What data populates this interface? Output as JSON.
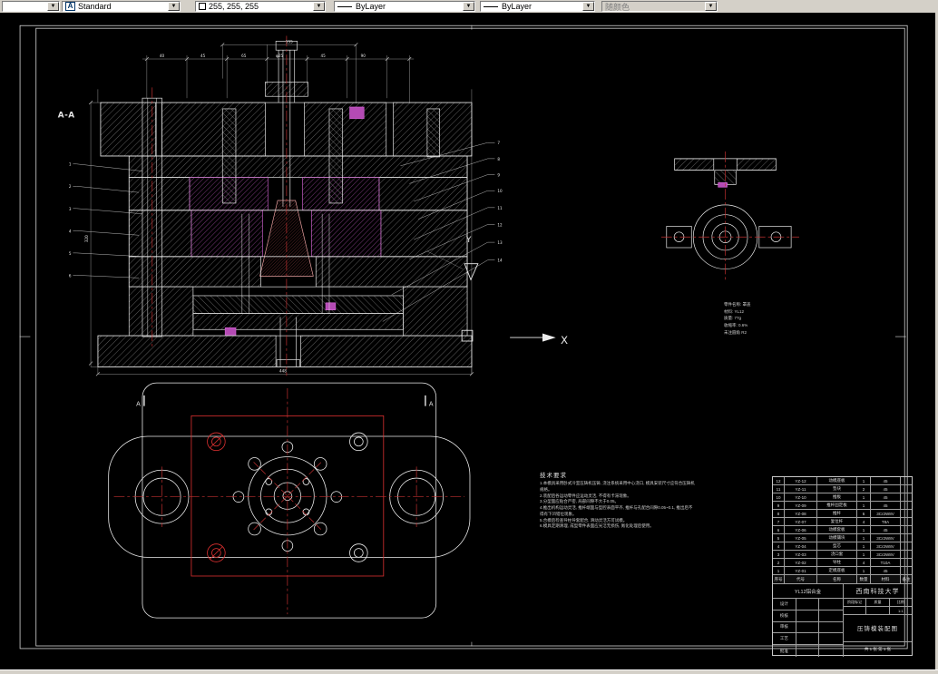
{
  "toolbar": {
    "layer_value": "",
    "style_value": "Standard",
    "style_icon": "A",
    "color_value": "255, 255, 255",
    "color_swatch": "#ffffff",
    "linetype_value": "ByLayer",
    "lineweight_value": "ByLayer",
    "plotstyle_value": "随颜色"
  },
  "drawing": {
    "section_label": "A-A",
    "plan_arrow_left": "A",
    "plan_arrow_right": "A",
    "ucs": {
      "x": "X",
      "y": "Y"
    },
    "dims": {
      "top": [
        "40",
        "45",
        "65",
        "φ25",
        "45",
        "90"
      ],
      "top_overall": "155",
      "left_overall": "320",
      "bottom_overall": "448"
    },
    "balloons": {
      "left": [
        "1",
        "2",
        "3",
        "4",
        "5",
        "6"
      ],
      "right": [
        "7",
        "8",
        "9",
        "10",
        "11",
        "12",
        "13",
        "14"
      ]
    },
    "part_params": [
      "零件名称: 罩盖",
      "材料: YL12",
      "质量: 77g",
      "收缩率: 0.6%",
      "未注圆角 R2"
    ],
    "tech_notes": {
      "title": "技术要求",
      "lines": [
        "1.本模具采用卧式冷室压铸机压铸, 浇注系统采用中心浇口, 模具安装尺寸应符合压铸机规格。",
        "2.装配后各运动零件应运动灵活, 不得有卡滞现象。",
        "3.分型面应贴合严密, 局部间隙不大于0.05。",
        "4.推出机构运动灵活, 推杆端面与型腔表面平齐, 推杆与孔配合间隙0.05~0.1, 推出后不得有下凹错位现象。",
        "5.合模后检查导柱导套配合, 滑动灵活方可试模。",
        "6.模具定期清理, 成型零件表面应光洁无损伤, 氮化处理后使用。"
      ]
    }
  },
  "title_block": {
    "header": {
      "seq": "序号",
      "code": "代号",
      "name": "名称",
      "qty": "数量",
      "material": "材料",
      "note": "备注"
    },
    "parts": [
      {
        "seq": "12",
        "code": "YZ-12",
        "name": "动模座板",
        "qty": "1",
        "material": "45",
        "note": ""
      },
      {
        "seq": "11",
        "code": "YZ-11",
        "name": "垫块",
        "qty": "2",
        "material": "45",
        "note": ""
      },
      {
        "seq": "10",
        "code": "YZ-10",
        "name": "推板",
        "qty": "1",
        "material": "45",
        "note": ""
      },
      {
        "seq": "9",
        "code": "YZ-09",
        "name": "推杆固定板",
        "qty": "1",
        "material": "45",
        "note": ""
      },
      {
        "seq": "8",
        "code": "YZ-08",
        "name": "推杆",
        "qty": "6",
        "material": "3Cr2W8V",
        "note": ""
      },
      {
        "seq": "7",
        "code": "YZ-07",
        "name": "复位杆",
        "qty": "4",
        "material": "T8A",
        "note": ""
      },
      {
        "seq": "6",
        "code": "YZ-06",
        "name": "动模套板",
        "qty": "1",
        "material": "45",
        "note": ""
      },
      {
        "seq": "5",
        "code": "YZ-05",
        "name": "动模镶块",
        "qty": "1",
        "material": "3Cr2W8V",
        "note": ""
      },
      {
        "seq": "4",
        "code": "YZ-04",
        "name": "型芯",
        "qty": "1",
        "material": "3Cr2W8V",
        "note": ""
      },
      {
        "seq": "3",
        "code": "YZ-03",
        "name": "浇口套",
        "qty": "1",
        "material": "3Cr2W8V",
        "note": ""
      },
      {
        "seq": "2",
        "code": "YZ-02",
        "name": "导柱",
        "qty": "4",
        "material": "T10A",
        "note": ""
      },
      {
        "seq": "1",
        "code": "YZ-01",
        "name": "定模座板",
        "qty": "1",
        "material": "45",
        "note": ""
      }
    ],
    "material": "YL12铝合金",
    "school": "西南科技大学",
    "sign_rows": [
      "设计",
      "校核",
      "审核",
      "工艺",
      "批准"
    ],
    "stage_labels": [
      "阶段标记",
      "质量",
      "比例"
    ],
    "scale": "1:1",
    "title": "压铸模装配图",
    "sheet_info": "共 1 张 第 1 张"
  },
  "colors": {
    "centerline": "#c03030",
    "insert_outline": "#e03131",
    "magenta": "#c75fc7",
    "line": "#e6e6e6"
  }
}
